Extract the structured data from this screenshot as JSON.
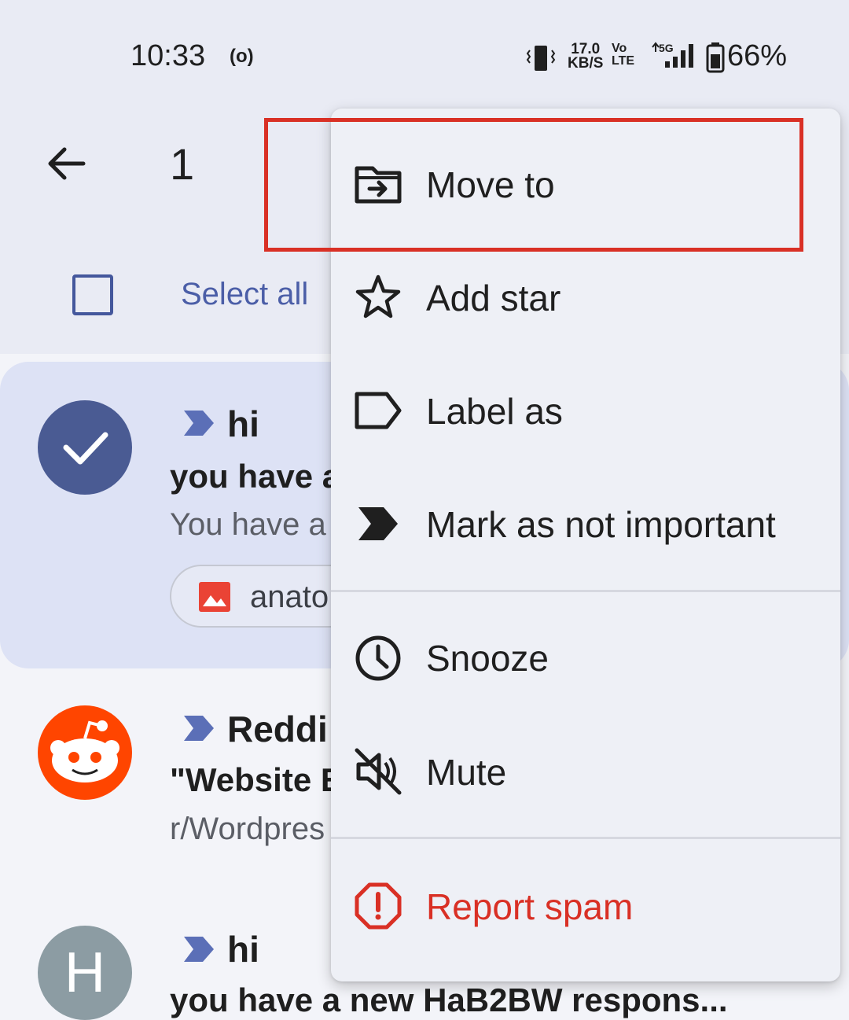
{
  "status_bar": {
    "time": "10:33",
    "hotspot": "(o)",
    "net_speed_value": "17.0",
    "net_speed_unit": "KB/S",
    "volte_top": "Vo",
    "volte_bottom": "LTE",
    "network": "5G",
    "battery": "66%"
  },
  "toolbar": {
    "selected_count": "1",
    "select_all": "Select all"
  },
  "emails": [
    {
      "sender": "hi",
      "subject": "you have a",
      "snippet": "You have a",
      "attachment": "anato",
      "selected": true
    },
    {
      "sender": "Reddi",
      "subject": "\"Website E",
      "snippet": "r/Wordpres"
    },
    {
      "avatar_letter": "H",
      "sender": "hi",
      "subject": "you have a new HaB2BW respons..."
    }
  ],
  "menu": {
    "items": [
      {
        "label": "Move to",
        "icon": "move-to-folder-icon"
      },
      {
        "label": "Add star",
        "icon": "star-outline-icon"
      },
      {
        "label": "Label as",
        "icon": "label-outline-icon"
      },
      {
        "label": "Mark as not important",
        "icon": "important-marker-icon"
      },
      {
        "label": "Snooze",
        "icon": "clock-icon"
      },
      {
        "label": "Mute",
        "icon": "mute-icon"
      },
      {
        "label": "Report spam",
        "icon": "report-spam-icon"
      }
    ]
  },
  "colors": {
    "accent": "#4b5ea7",
    "spam_red": "#d93025",
    "highlight_red": "#d93025",
    "reddit_orange": "#ff4500"
  }
}
